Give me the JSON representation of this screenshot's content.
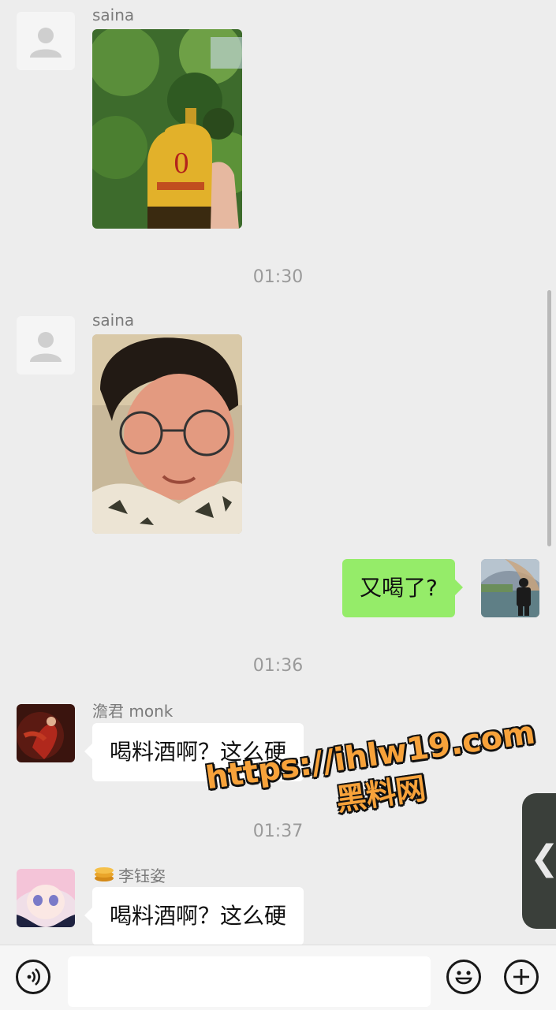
{
  "messages": [
    {
      "sender": "saina"
    },
    {
      "time": "01:30"
    },
    {
      "sender": "saina"
    },
    {
      "self_text": "又喝了?"
    },
    {
      "time": "01:36"
    },
    {
      "sender": "澹君 monk",
      "text": "喝料酒啊？这么硬"
    },
    {
      "time": "01:37"
    },
    {
      "sender": "李钰姿",
      "text": "喝料酒啊？这么硬"
    }
  ],
  "watermark": {
    "url": "https://ihlw19.com",
    "name": "黑料网"
  },
  "side_handle": {
    "glyph": "❮"
  },
  "icons": [
    "avatar-placeholder-icon",
    "voice-icon",
    "emoji-icon",
    "plus-icon",
    "coin-badge-icon"
  ],
  "colors": {
    "self_bubble": "#95ec69",
    "other_bubble": "#ffffff",
    "background": "#ededed",
    "watermark": "#f7a23a"
  }
}
